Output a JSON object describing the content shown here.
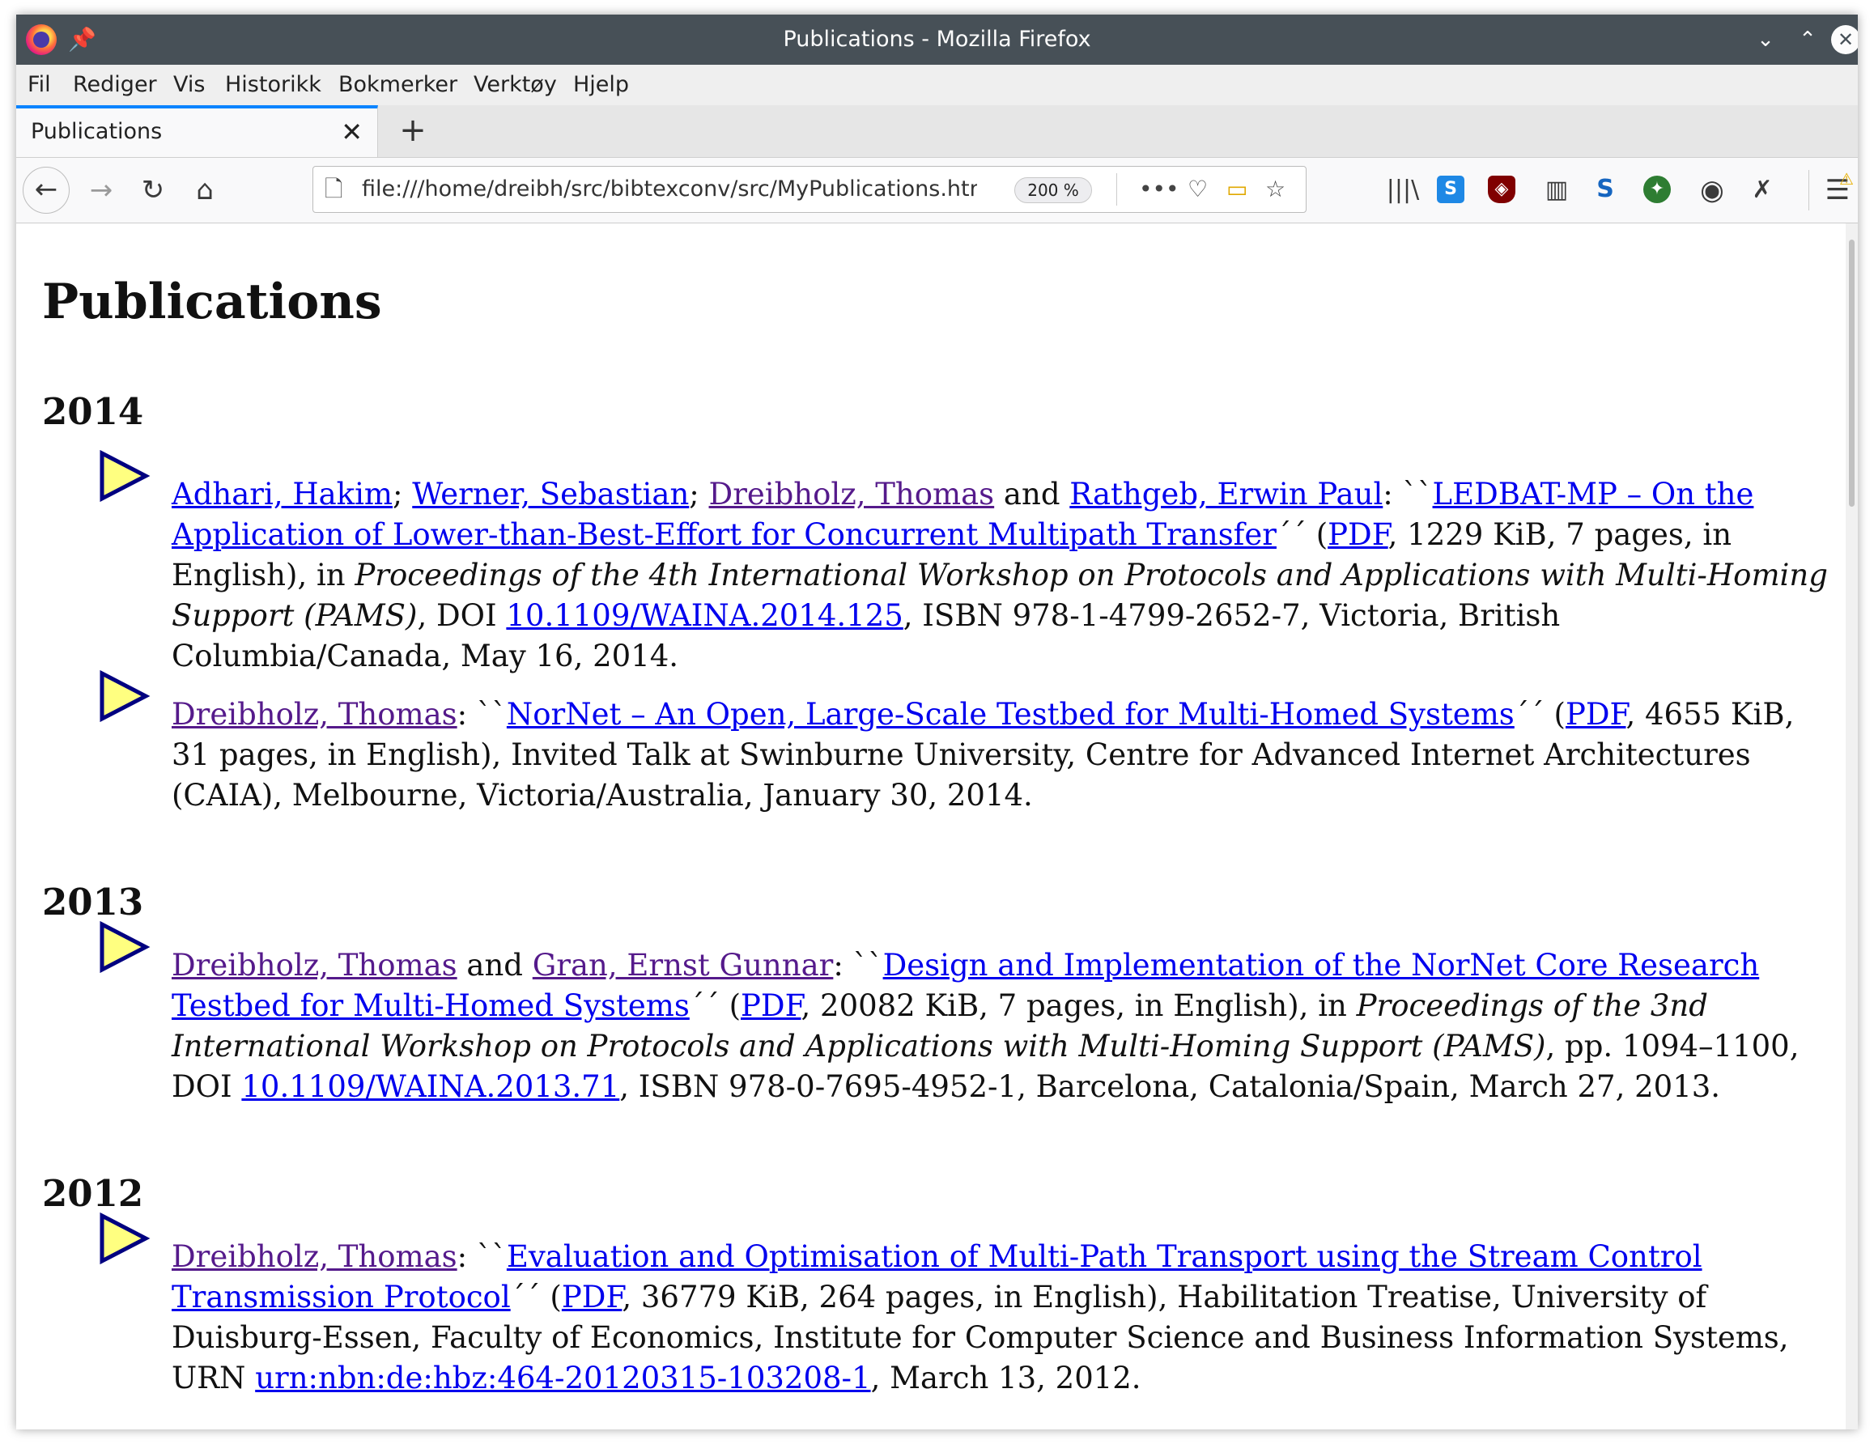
{
  "window": {
    "title": "Publications - Mozilla Firefox"
  },
  "menu": [
    "Fil",
    "Rediger",
    "Vis",
    "Historikk",
    "Bokmerker",
    "Verktøy",
    "Hjelp"
  ],
  "tab": {
    "title": "Publications",
    "close": "✕",
    "new_tab": "+"
  },
  "nav": {
    "url": "file:///home/dreibh/src/bibtexconv/src/MyPublications.htm",
    "zoom": "200 %"
  },
  "page": {
    "title": "Publications",
    "years": [
      "2014",
      "2013",
      "2012"
    ],
    "entries": [
      {
        "authors": [
          "Adhari, Hakim",
          "Werner, Sebastian",
          "Dreibholz, Thomas",
          "Rathgeb, Erwin Paul"
        ],
        "sep1": "; ",
        "sep2": "; ",
        "and": " and ",
        "colon": ": ``",
        "title": "LEDBAT-MP – On the Application of Lower-than-Best-Effort for Concurrent Multipath Transfer",
        "close": "´´ (",
        "pdf": "PDF",
        "details": ", 1229 KiB, 7 pages, in English), in ",
        "venue": "Proceedings of the 4th International Workshop on Protocols and Applications with Multi-Homing Support (PAMS)",
        "doi_label": ", DOI ",
        "doi": "10.1109/WAINA.2014.125",
        "rest": ", ISBN 978-1-4799-2652-7, Victoria, British Columbia/Canada, May 16, 2014."
      },
      {
        "authors": [
          "Dreibholz, Thomas"
        ],
        "colon": ": ``",
        "title": "NorNet – An Open, Large-Scale Testbed for Multi-Homed Systems",
        "close": "´´ (",
        "pdf": "PDF",
        "rest": ", 4655 KiB, 31 pages, in English), Invited Talk at Swinburne University, Centre for Advanced Internet Architectures (CAIA), Melbourne, Victoria/Australia, January 30, 2014."
      },
      {
        "authors": [
          "Dreibholz, Thomas",
          "Gran, Ernst Gunnar"
        ],
        "and": " and ",
        "colon": ": ``",
        "title": "Design and Implementation of the NorNet Core Research Testbed for Multi-Homed Systems",
        "close": "´´ (",
        "pdf": "PDF",
        "details": ", 20082 KiB, 7 pages, in English), in ",
        "venue": "Proceedings of the 3nd International Workshop on Protocols and Applications with Multi-Homing Support (PAMS)",
        "doi_label": ", pp. 1094–1100, DOI ",
        "doi": "10.1109/WAINA.2013.71",
        "rest": ", ISBN 978-0-7695-4952-1, Barcelona, Catalonia/Spain, March 27, 2013."
      },
      {
        "authors": [
          "Dreibholz, Thomas"
        ],
        "colon": ": ``",
        "title": "Evaluation and Optimisation of Multi-Path Transport using the Stream Control Transmission Protocol",
        "close": "´´ (",
        "pdf": "PDF",
        "details": ", 36779 KiB, 264 pages, in English), Habilitation Treatise, University of Duisburg-Essen, Faculty of Economics, Institute for Computer Science and Business Information Systems, URN ",
        "urn": "urn:nbn:de:hbz:464-20120315-103208-1",
        "rest": ", March 13, 2012."
      }
    ]
  },
  "colors": {
    "link": "#0000ee",
    "visited": "#551a8b",
    "titlebar": "#475057",
    "accent": "#0a84ff",
    "bullet_fill": "#ffff80",
    "bullet_stroke": "#000080"
  }
}
